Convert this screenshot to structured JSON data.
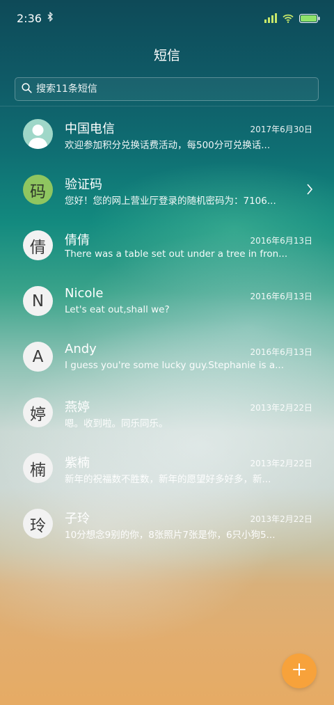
{
  "status_bar": {
    "time": "2:36",
    "icons": [
      "bluetooth-icon",
      "signal-icon",
      "wifi-icon",
      "battery-icon"
    ]
  },
  "header": {
    "title": "短信"
  },
  "search": {
    "placeholder": "搜索11条短信"
  },
  "conversations": [
    {
      "avatar": "",
      "avatar_icon": "person-icon",
      "name": "中国电信",
      "date": "2017年6月30日",
      "preview": "欢迎参加积分兑换话费活动，每500分可兑换话..."
    },
    {
      "avatar": "码",
      "name": "验证码",
      "date": "",
      "preview": "您好！您的网上营业厅登录的随机密码为：7106...",
      "has_chevron": true
    },
    {
      "avatar": "倩",
      "name": "倩倩",
      "date": "2016年6月13日",
      "preview": "There was a table set out under a tree in fron..."
    },
    {
      "avatar": "N",
      "name": "Nicole",
      "date": "2016年6月13日",
      "preview": "Let's eat out,shall we?"
    },
    {
      "avatar": "A",
      "name": "Andy",
      "date": "2016年6月13日",
      "preview": "I guess you're some lucky guy.Stephanie is a..."
    },
    {
      "avatar": "婷",
      "name": "燕婷",
      "date": "2013年2月22日",
      "preview": "嗯。收到啦。同乐同乐。"
    },
    {
      "avatar": "楠",
      "name": "紫楠",
      "date": "2013年2月22日",
      "preview": "新年的祝福数不胜数，新年的愿望好多好多，新..."
    },
    {
      "avatar": "玲",
      "name": "子玲",
      "date": "2013年2月22日",
      "preview": "10分想念9别的你，8张照片7张是你，6只小狗5..."
    }
  ],
  "fab": {
    "icon": "plus-icon",
    "color": "#f7a23b"
  },
  "colors": {
    "signal": "#c8e86a",
    "battery": "#8fe36a",
    "accent": "#f7a23b"
  }
}
